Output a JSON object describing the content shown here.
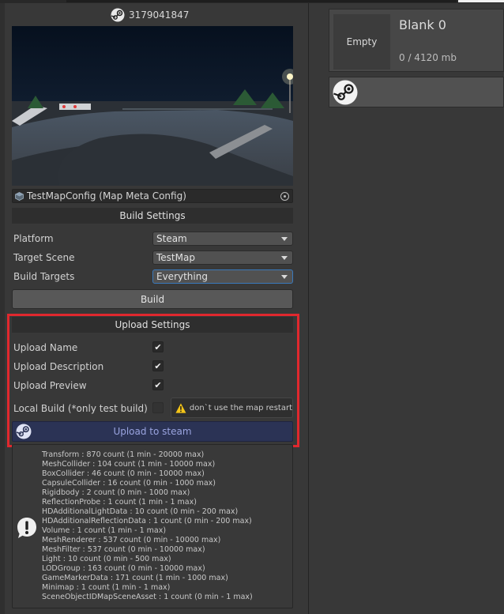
{
  "header": {
    "item_id": "3179041847"
  },
  "config": {
    "field_text": "TestMapConfig (Map Meta Config)"
  },
  "build_settings": {
    "title": "Build Settings",
    "platform_label": "Platform",
    "platform_value": "Steam",
    "target_scene_label": "Target Scene",
    "target_scene_value": "TestMap",
    "build_targets_label": "Build Targets",
    "build_targets_value": "Everything",
    "build_button": "Build"
  },
  "upload_settings": {
    "title": "Upload Settings",
    "rows": [
      {
        "label": "Upload Name",
        "checked": true
      },
      {
        "label": "Upload Description",
        "checked": true
      },
      {
        "label": "Upload Preview",
        "checked": true
      },
      {
        "label": "Local Build (*only test build)",
        "checked": false
      }
    ],
    "warning": "don`t use the map restart",
    "upload_button": "Upload to steam"
  },
  "stats": [
    "Transform : 870 count (1 min - 20000 max)",
    "MeshCollider : 104 count (1 min - 10000 max)",
    "BoxCollider : 46 count (0 min - 10000 max)",
    "CapsuleCollider : 16 count (0 min - 1000 max)",
    "Rigidbody : 2 count (0 min - 1000 max)",
    "ReflectionProbe : 1 count (1 min - 1 max)",
    "HDAdditionalLightData : 10 count (0 min - 200 max)",
    "HDAdditionalReflectionData : 1 count (0 min - 200 max)",
    "Volume : 1 count (1 min - 1 max)",
    "MeshRenderer : 537 count (0 min - 10000 max)",
    "MeshFilter : 537 count (0 min - 10000 max)",
    "Light : 10 count (0 min - 500 max)",
    "LODGroup : 163 count (0 min - 10000 max)",
    "GameMarkerData : 171 count (1 min - 1000 max)",
    "Minimap : 1 count (1 min - 1 max)",
    "SceneObjectIDMapSceneAsset : 1 count (0 min - 1 max)"
  ],
  "slot": {
    "thumb_label": "Empty",
    "title": "Blank 0",
    "size": "0 / 4120 mb"
  },
  "icons": {
    "steam": "steam-icon",
    "config": "scriptable-object-icon",
    "target": "object-picker-icon",
    "warning": "warning-icon",
    "info": "info-bubble-icon"
  },
  "colors": {
    "highlight_border": "#e0282e",
    "upload_button_bg": "#2b3355",
    "upload_button_text": "#9aa4df",
    "focus_border": "#3a79bb",
    "warning_yellow": "#f5c518"
  }
}
